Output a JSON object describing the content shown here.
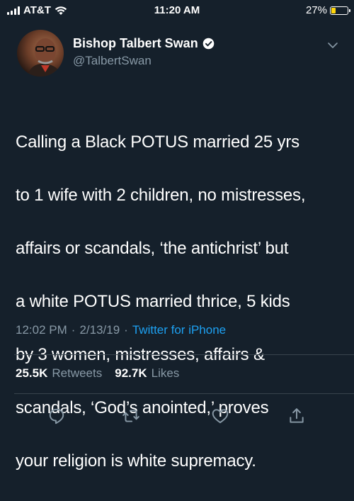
{
  "status_bar": {
    "carrier": "AT&T",
    "time": "11:20 AM",
    "battery_percent_label": "27%",
    "battery_level": 0.27,
    "icons": [
      "signal-bars-icon",
      "wifi-icon",
      "battery-icon"
    ]
  },
  "tweet": {
    "display_name": "Bishop Talbert Swan",
    "handle": "@TalbertSwan",
    "verified": true,
    "text_lines": [
      "Calling a Black POTUS married 25 yrs",
      "to 1 wife with 2 children, no mistresses,",
      "affairs or scandals, ‘the antichrist’ but",
      "a white POTUS married thrice, 5 kids",
      "by 3 women, mistresses, affairs &",
      "scandals, ‘God’s anointed,’ proves",
      "your religion is white supremacy."
    ],
    "time": "12:02 PM",
    "separator": "·",
    "date": "2/13/19",
    "source": "Twitter for iPhone"
  },
  "stats": {
    "retweets_count": "25.5K",
    "retweets_label": "Retweets",
    "likes_count": "92.7K",
    "likes_label": "Likes"
  },
  "actions": [
    "reply-icon",
    "retweet-icon",
    "like-icon",
    "share-icon"
  ],
  "colors": {
    "background": "#15202b",
    "secondary_text": "#8899a6",
    "accent": "#1da1f2",
    "divider": "#38444d",
    "battery": "#ffd60a"
  }
}
